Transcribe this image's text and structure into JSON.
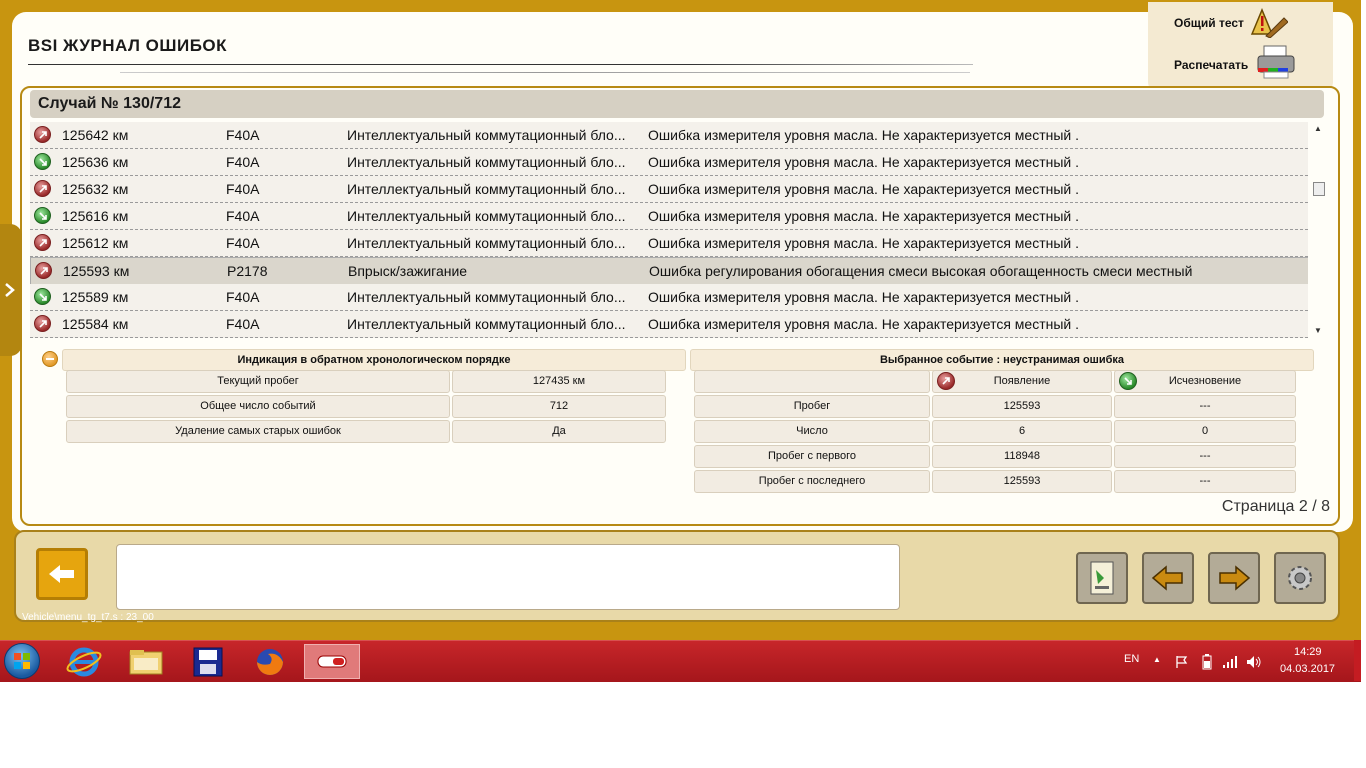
{
  "window": {
    "title": "BSI  ЖУРНАЛ ОШИБОК"
  },
  "top_actions": {
    "general_test": "Общий тест",
    "print": "Распечатать"
  },
  "case": {
    "label": "Случай № 130/712"
  },
  "fault_list": [
    {
      "type": "appearance",
      "mileage": "125642 км",
      "code": "F40A",
      "system": "Интеллектуальный коммутационный бло...",
      "description": "Ошибка измерителя уровня масла. Не характеризуется местный ."
    },
    {
      "type": "disappearance",
      "mileage": "125636 км",
      "code": "F40A",
      "system": "Интеллектуальный коммутационный бло...",
      "description": "Ошибка измерителя уровня масла. Не характеризуется местный ."
    },
    {
      "type": "appearance",
      "mileage": "125632 км",
      "code": "F40A",
      "system": "Интеллектуальный коммутационный бло...",
      "description": "Ошибка измерителя уровня масла. Не характеризуется местный ."
    },
    {
      "type": "disappearance",
      "mileage": "125616 км",
      "code": "F40A",
      "system": "Интеллектуальный коммутационный бло...",
      "description": "Ошибка измерителя уровня масла. Не характеризуется местный ."
    },
    {
      "type": "appearance",
      "mileage": "125612 км",
      "code": "F40A",
      "system": "Интеллектуальный коммутационный бло...",
      "description": "Ошибка измерителя уровня масла. Не характеризуется местный ."
    },
    {
      "type": "appearance",
      "mileage": "125593 км",
      "code": "P2178",
      "system": "Впрыск/зажигание",
      "description": "Ошибка регулирования обогащения смеси высокая обогащенность смеси местный",
      "selected": true
    },
    {
      "type": "disappearance",
      "mileage": "125589 км",
      "code": "F40A",
      "system": "Интеллектуальный коммутационный бло...",
      "description": "Ошибка измерителя уровня масла. Не характеризуется местный ."
    },
    {
      "type": "appearance",
      "mileage": "125584 км",
      "code": "F40A",
      "system": "Интеллектуальный коммутационный бло...",
      "description": "Ошибка измерителя уровня масла. Не характеризуется местный ."
    }
  ],
  "summary": {
    "title": "Индикация в обратном хронологическом порядке",
    "rows": [
      {
        "label": "Текущий пробег",
        "value": "127435 км"
      },
      {
        "label": "Общее число событий",
        "value": "712"
      },
      {
        "label": "Удаление самых старых ошибок",
        "value": "Да"
      }
    ]
  },
  "event": {
    "title": "Выбранное событие : неустранимая ошибка",
    "col_appearance": "Появление",
    "col_disappearance": "Исчезновение",
    "rows": [
      {
        "label": "Пробег",
        "appearance": "125593",
        "disappearance": "---"
      },
      {
        "label": "Число",
        "appearance": "6",
        "disappearance": "0"
      },
      {
        "label": "Пробег с первого",
        "appearance": "118948",
        "disappearance": "---"
      },
      {
        "label": "Пробег с последнего",
        "appearance": "125593",
        "disappearance": "---"
      }
    ]
  },
  "pagination": {
    "text": "Страница 2 / 8"
  },
  "status_path": "Vehicle\\menu_tg_t7.s : 23_00",
  "message_box": "",
  "taskbar": {
    "language": "EN",
    "time": "14:29",
    "date": "04.03.2017"
  },
  "colors": {
    "accent": "#c89510",
    "taskbar": "#b81f24",
    "selected_row": "#dad6cc"
  }
}
